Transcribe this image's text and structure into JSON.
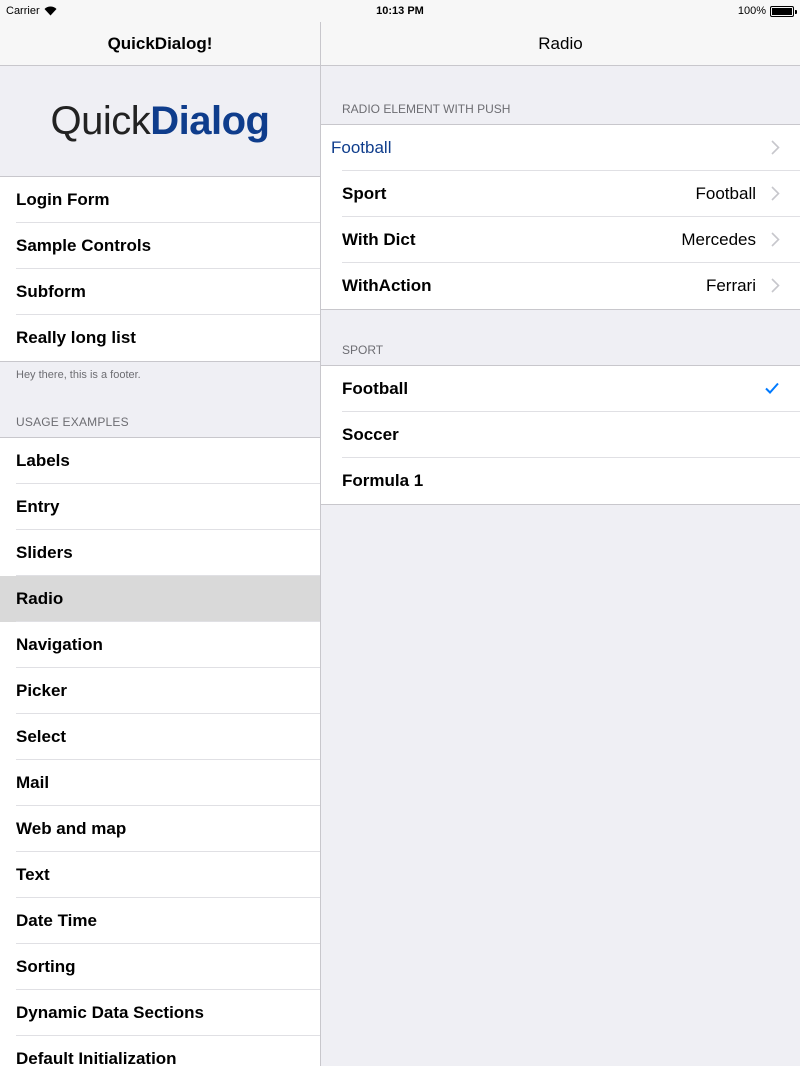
{
  "status": {
    "carrier": "Carrier",
    "time": "10:13 PM",
    "battery": "100%"
  },
  "master": {
    "title": "QuickDialog!",
    "logo": {
      "part1": "Quick",
      "part2": "Dialog"
    },
    "section1_items": [
      "Login Form",
      "Sample Controls",
      "Subform",
      "Really long list"
    ],
    "section1_footer": "Hey there, this is a footer.",
    "section2_header": "USAGE EXAMPLES",
    "section2_items": [
      "Labels",
      "Entry",
      "Sliders",
      "Radio",
      "Navigation",
      "Picker",
      "Select",
      "Mail",
      "Web and map",
      "Text",
      "Date Time",
      "Sorting",
      "Dynamic Data Sections",
      "Default Initialization"
    ],
    "selected": "Radio"
  },
  "detail": {
    "title": "Radio",
    "section1_header": "RADIO ELEMENT WITH PUSH",
    "push_link": "Football",
    "push_rows": [
      {
        "label": "Sport",
        "value": "Football"
      },
      {
        "label": "With Dict",
        "value": "Mercedes"
      },
      {
        "label": "WithAction",
        "value": "Ferrari"
      }
    ],
    "section2_header": "SPORT",
    "sport_options": [
      "Football",
      "Soccer",
      "Formula 1"
    ],
    "sport_selected": "Football"
  },
  "colors": {
    "accent": "#007aff",
    "brand": "#0f3d8c",
    "selected_row": "#d9d9d9",
    "background": "#efeff4"
  }
}
